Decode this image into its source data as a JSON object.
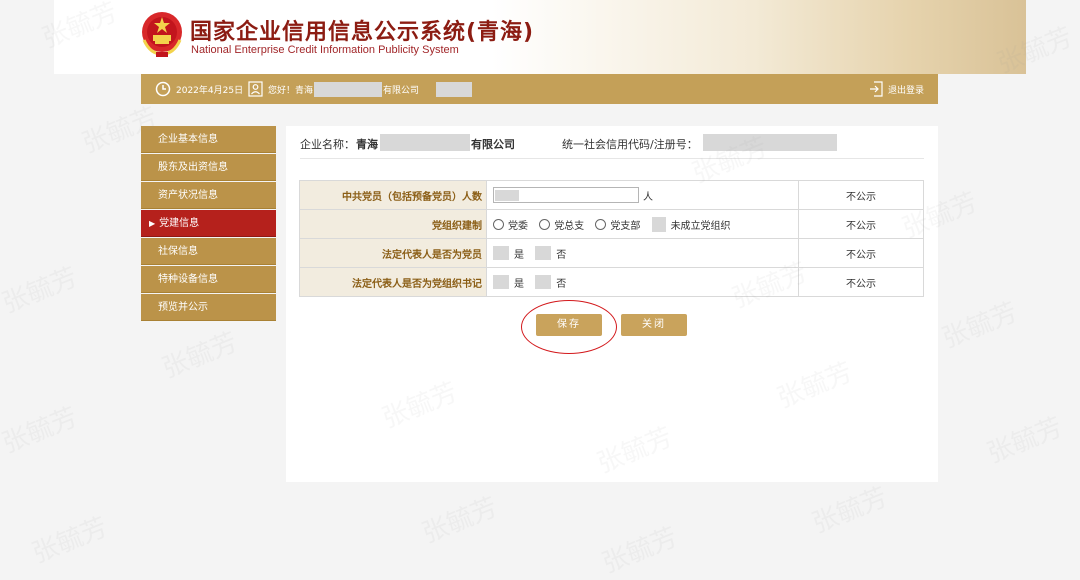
{
  "header": {
    "title_cn": "国家企业信用信息公示系统(青海)",
    "title_en": "National Enterprise Credit Information Publicity System"
  },
  "topbar": {
    "date": "2022年4月25日",
    "greeting": "您好！青海",
    "company_suffix": "有限公司",
    "logout": "退出登录"
  },
  "sidebar": {
    "items": [
      {
        "label": "企业基本信息"
      },
      {
        "label": "股东及出资信息"
      },
      {
        "label": "资产状况信息"
      },
      {
        "label": "党建信息",
        "active": true
      },
      {
        "label": "社保信息"
      },
      {
        "label": "特种设备信息"
      },
      {
        "label": "预览并公示"
      }
    ]
  },
  "company": {
    "name_label": "企业名称：",
    "name_prefix": "青海",
    "name_suffix": "有限公司",
    "code_label": "统一社会信用代码/注册号："
  },
  "form": {
    "rows": [
      {
        "label": "中共党员（包括预备党员）人数",
        "unit": "人",
        "public": "不公示"
      },
      {
        "label": "党组织建制",
        "options": [
          "党委",
          "党总支",
          "党支部",
          "未成立党组织"
        ],
        "public": "不公示"
      },
      {
        "label": "法定代表人是否为党员",
        "yes": "是",
        "no": "否",
        "public": "不公示"
      },
      {
        "label": "法定代表人是否为党组织书记",
        "yes": "是",
        "no": "否",
        "public": "不公示"
      }
    ]
  },
  "buttons": {
    "save": "保存",
    "close": "关闭"
  },
  "watermark": "张毓芳",
  "colors": {
    "gold": "#c4a058",
    "sidebar_gold": "#bb9349",
    "active_red": "#b5211c",
    "title_red": "#8c1c12",
    "annotation_red": "#d3191c"
  }
}
